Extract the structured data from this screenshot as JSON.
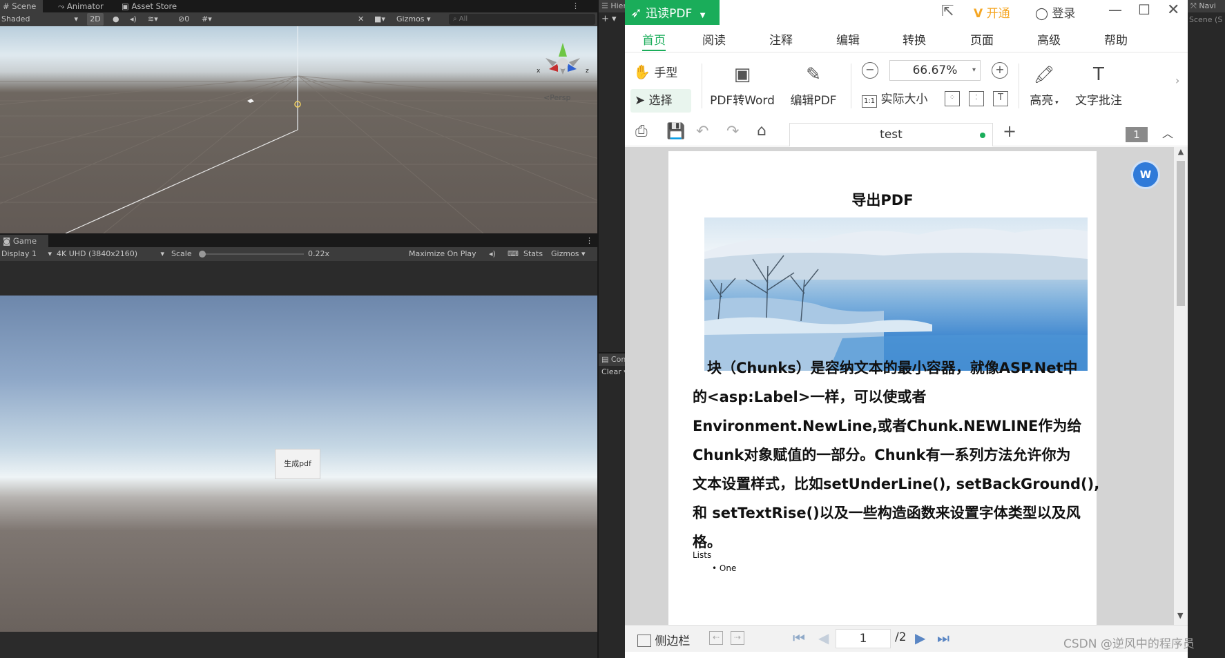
{
  "unity": {
    "tabs": {
      "scene": "Scene",
      "animator": "Animator",
      "asset_store": "Asset Store",
      "game": "Game",
      "hierarchy": "Hiera",
      "console": "Cons",
      "navigation": "Navi"
    },
    "scene_toolbar": {
      "shading": "Shaded",
      "mode_2d": "2D",
      "hidden_count": "0",
      "gizmos": "Gizmos",
      "search_placeholder": "All",
      "persp_label": "Persp"
    },
    "game_toolbar": {
      "display": "Display 1",
      "resolution": "4K UHD (3840x2160)",
      "scale_label": "Scale",
      "scale_value": "0.22x",
      "maximize": "Maximize On Play",
      "stats": "Stats",
      "gizmos": "Gizmos"
    },
    "console": {
      "clear": "Clear"
    },
    "hierarchy": {
      "add": "+"
    },
    "navigation_scene": "Scene (S",
    "game_button": "生成pdf",
    "gizmo_axes": {
      "x": "x",
      "z": "z"
    }
  },
  "pdf": {
    "app_name": "迅读PDF",
    "vip_label": "开通",
    "login": "登录",
    "ribbon_tabs": [
      "首页",
      "阅读",
      "注释",
      "编辑",
      "转换",
      "页面",
      "高级",
      "帮助"
    ],
    "tools": {
      "hand": "手型",
      "select": "选择",
      "pdf_to_word": "PDF转Word",
      "edit_pdf": "编辑PDF",
      "zoom": "66.67%",
      "actual_size": "实际大小",
      "highlight": "高亮",
      "text_comment": "文字批注"
    },
    "doc_tab": "test",
    "page_badge": "1",
    "document": {
      "title": "导出PDF",
      "paragraph_lines": [
        "　块（Chunks）是容纳文本的最小容器，就像ASP.Net中",
        "的<asp:Label>一样，可以使或者",
        "Environment.NewLine,或者Chunk.NEWLINE作为给",
        "Chunk对象赋值的一部分。Chunk有一系列方法允许你为",
        "文本设置样式，比如setUnderLine(), setBackGround(),",
        "和 setTextRise()以及一些构造函数来设置字体类型以及风",
        "格。"
      ],
      "lists_label": "Lists",
      "list_items": [
        "One"
      ]
    },
    "status": {
      "sidebar": "侧边栏",
      "page_current": "1",
      "page_total": "/2"
    }
  },
  "watermark": "CSDN @逆风中的程序员",
  "colors": {
    "pdf_brand": "#1aad5a",
    "accent_blue": "#2f7ad9",
    "unity_bg": "#191919",
    "unity_toolbar": "#3c3c3c"
  }
}
